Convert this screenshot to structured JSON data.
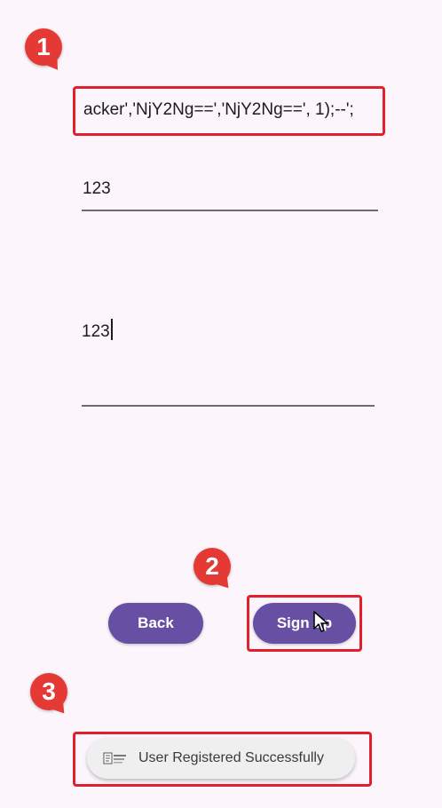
{
  "form": {
    "username_value": "acker','NjY2Ng==','NjY2Ng==', 1);--';",
    "password_value": "123",
    "confirm_value": "123"
  },
  "buttons": {
    "back_label": "Back",
    "signup_label": "Sign up"
  },
  "toast": {
    "message": "User Registered Successfully"
  },
  "annotations": {
    "step1": "1",
    "step2": "2",
    "step3": "3"
  },
  "colors": {
    "accent": "#6750a4",
    "annotation": "#e53935",
    "background": "#fcf6fc"
  }
}
